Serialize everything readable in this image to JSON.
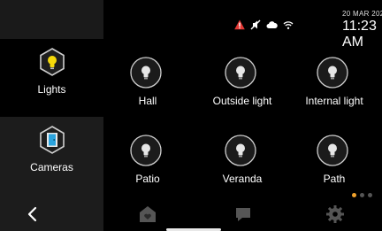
{
  "status_bar": {
    "date": "20 MAR 2024",
    "time": "11:23 AM",
    "icons": [
      "alert-icon",
      "mute-icon",
      "cloud-icon",
      "wifi-icon"
    ],
    "alert_color": "#e53935"
  },
  "sidebar": {
    "items": [
      {
        "label": "Lights",
        "icon": "bulb-icon",
        "active": true,
        "accent": "#f5d90a"
      },
      {
        "label": "Cameras",
        "icon": "door-icon",
        "active": false,
        "accent": "#2aa3dd"
      }
    ]
  },
  "lights": [
    {
      "label": "Hall",
      "icon": "bulb-icon",
      "state": "off"
    },
    {
      "label": "Outside light",
      "icon": "bulb-icon",
      "state": "off"
    },
    {
      "label": "Internal light",
      "icon": "bulb-icon",
      "state": "off"
    },
    {
      "label": "Patio",
      "icon": "bulb-icon",
      "state": "off"
    },
    {
      "label": "Veranda",
      "icon": "bulb-icon",
      "state": "off"
    },
    {
      "label": "Path",
      "icon": "bulb-icon",
      "state": "off"
    }
  ],
  "pagination": {
    "pages": 3,
    "current": 1,
    "active_color": "#f0a12c"
  },
  "bottom_nav": {
    "items": [
      "back-icon",
      "home-icon",
      "messages-icon",
      "settings-icon"
    ]
  }
}
